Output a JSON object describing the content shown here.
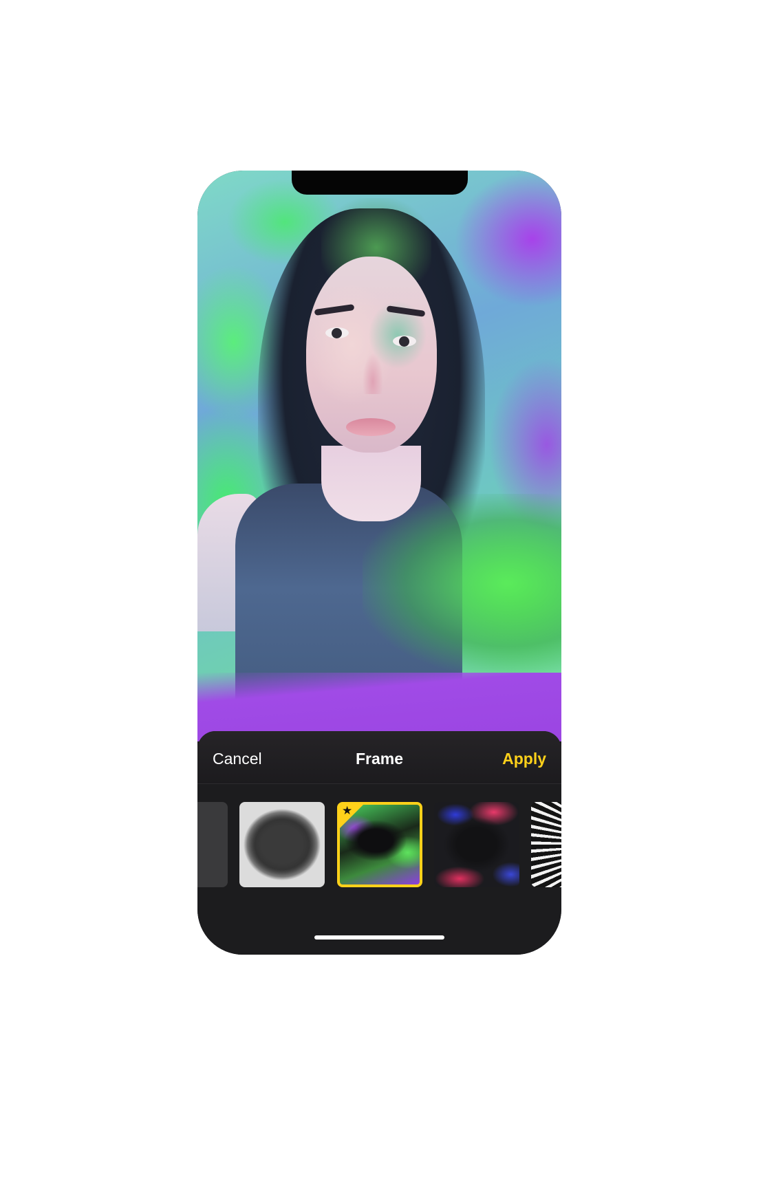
{
  "toolbar": {
    "cancel_label": "Cancel",
    "title": "Frame",
    "apply_label": "Apply"
  },
  "frames": [
    {
      "name": "frame-partial"
    },
    {
      "name": "frame-grunge-gray"
    },
    {
      "name": "frame-paint-green-purple",
      "selected": true,
      "badge_icon": "star-icon"
    },
    {
      "name": "frame-paint-pink-blue"
    },
    {
      "name": "frame-rays"
    }
  ],
  "colors": {
    "accent": "#ffd11a",
    "sheet_background": "#1c1c1e",
    "text": "#ffffff"
  }
}
